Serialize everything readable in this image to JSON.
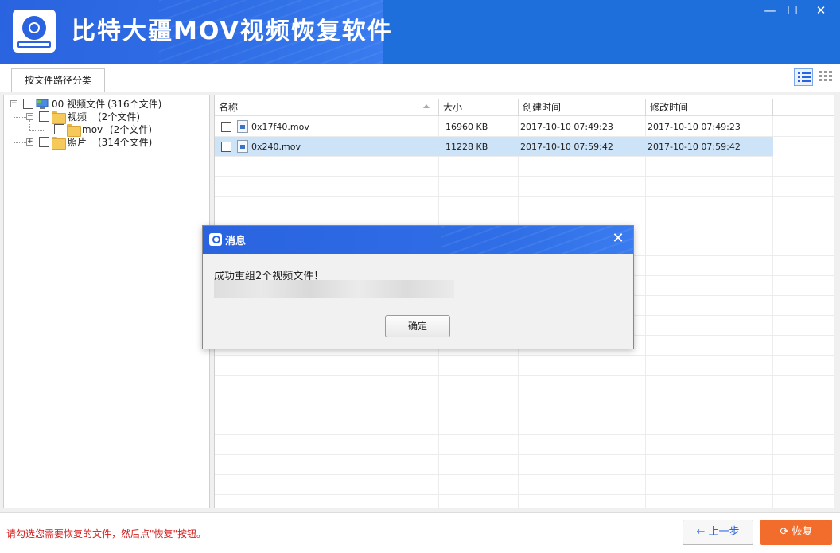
{
  "window": {
    "title": "比特大疆MOV视频恢复软件",
    "controls": {
      "minimize": "—",
      "maximize": "☐",
      "close": "✕"
    }
  },
  "tabs": [
    {
      "label": "按文件路径分类"
    }
  ],
  "tree": {
    "root": {
      "label": "00 视频文件",
      "count": "(316个文件)",
      "expander": "−"
    },
    "videos": {
      "label": "视频",
      "count": "(2个文件)",
      "expander": "−"
    },
    "mov": {
      "label": "mov",
      "count": "(2个文件)"
    },
    "photos": {
      "label": "照片",
      "count": "(314个文件)",
      "expander": "+"
    }
  },
  "table": {
    "columns": {
      "name": "名称",
      "size": "大小",
      "created": "创建时间",
      "modified": "修改时间"
    },
    "rows": [
      {
        "name": "0x17f40.mov",
        "size": "16960 KB",
        "created": "2017-10-10  07:49:23",
        "modified": "2017-10-10  07:49:23"
      },
      {
        "name": "0x240.mov",
        "size": "11228 KB",
        "created": "2017-10-10  07:59:42",
        "modified": "2017-10-10  07:59:42"
      }
    ]
  },
  "status": {
    "hint": "请勾选您需要恢复的文件，然后点\"恢复\"按钮。",
    "prev_label": "上一步",
    "recover_label": "恢复"
  },
  "dialog": {
    "title": "消息",
    "message": "成功重组2个视频文件！",
    "ok_label": "确定",
    "close": "✕"
  },
  "colors": {
    "brand_blue": "#2a63df",
    "recover_orange": "#f26d2b",
    "hint_red": "#d41c1c",
    "selected_row": "#cde3f7"
  }
}
